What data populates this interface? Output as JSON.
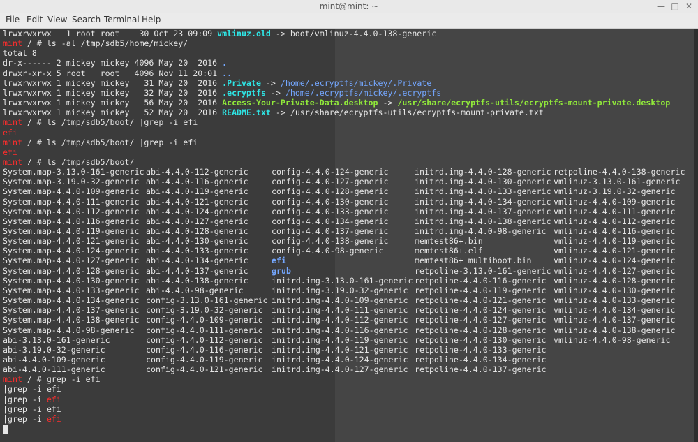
{
  "window": {
    "title": "mint@mint: ~",
    "menu": [
      "File",
      "Edit",
      "View",
      "Search",
      "Terminal",
      "Help"
    ],
    "controls": [
      "—",
      "□",
      "✕"
    ]
  },
  "terminal": {
    "lines": [
      [
        {
          "t": "lrwxrwxrwx   1 root root    30 Oct 23 09:09 "
        },
        {
          "t": "vmlinuz.old",
          "c": "cyan",
          "b": true
        },
        {
          "t": " -> boot/vmlinuz-4.4.0-138-generic"
        }
      ],
      [
        {
          "t": "mint",
          "c": "red"
        },
        {
          "t": " / # ls -al /tmp/sdb5/home/mickey/"
        }
      ],
      [
        {
          "t": "total 8"
        }
      ],
      [
        {
          "t": "dr-x------ 2 mickey mickey 4096 May 20  2016 "
        },
        {
          "t": ".",
          "c": "blue",
          "b": true
        }
      ],
      [
        {
          "t": "drwxr-xr-x 5 root   root   4096 Nov 11 20:01 "
        },
        {
          "t": "..",
          "c": "blue",
          "b": true
        }
      ],
      [
        {
          "t": "lrwxrwxrwx 1 mickey mickey   31 May 20  2016 "
        },
        {
          "t": ".Private",
          "c": "cyan",
          "b": true
        },
        {
          "t": " -> "
        },
        {
          "t": "/home/.ecryptfs/mickey/.Private",
          "c": "blue"
        }
      ],
      [
        {
          "t": "lrwxrwxrwx 1 mickey mickey   32 May 20  2016 "
        },
        {
          "t": ".ecryptfs",
          "c": "cyan",
          "b": true
        },
        {
          "t": " -> "
        },
        {
          "t": "/home/.ecryptfs/mickey/.ecryptfs",
          "c": "blue"
        }
      ],
      [
        {
          "t": "lrwxrwxrwx 1 mickey mickey   56 May 20  2016 "
        },
        {
          "t": "Access-Your-Private-Data.desktop",
          "c": "green",
          "b": true
        },
        {
          "t": " -> "
        },
        {
          "t": "/usr/share/ecryptfs-utils/ecryptfs-mount-private.desktop",
          "c": "green",
          "b": true
        }
      ],
      [
        {
          "t": "lrwxrwxrwx 1 mickey mickey   52 May 20  2016 "
        },
        {
          "t": "README.txt",
          "c": "cyan",
          "b": true
        },
        {
          "t": " -> /usr/share/ecryptfs-utils/ecryptfs-mount-private.txt"
        }
      ],
      [
        {
          "t": "mint",
          "c": "red"
        },
        {
          "t": " / # ls /tmp/sdb5/boot/ |grep -i efi"
        }
      ],
      [
        {
          "t": "efi",
          "c": "red"
        }
      ],
      [
        {
          "t": "mint",
          "c": "red"
        },
        {
          "t": " / # ls /tmp/sdb5/boot/ |grep -i efi"
        }
      ],
      [
        {
          "t": "efi",
          "c": "red"
        }
      ],
      [
        {
          "t": "mint",
          "c": "red"
        },
        {
          "t": " / # ls /tmp/sdb5/boot/"
        }
      ]
    ],
    "listing": {
      "columns": [
        [
          "System.map-3.13.0-161-generic",
          "System.map-3.19.0-32-generic",
          "System.map-4.4.0-109-generic",
          "System.map-4.4.0-111-generic",
          "System.map-4.4.0-112-generic",
          "System.map-4.4.0-116-generic",
          "System.map-4.4.0-119-generic",
          "System.map-4.4.0-121-generic",
          "System.map-4.4.0-124-generic",
          "System.map-4.4.0-127-generic",
          "System.map-4.4.0-128-generic",
          "System.map-4.4.0-130-generic",
          "System.map-4.4.0-133-generic",
          "System.map-4.4.0-134-generic",
          "System.map-4.4.0-137-generic",
          "System.map-4.4.0-138-generic",
          "System.map-4.4.0-98-generic",
          "abi-3.13.0-161-generic",
          "abi-3.19.0-32-generic",
          "abi-4.4.0-109-generic",
          "abi-4.4.0-111-generic"
        ],
        [
          "abi-4.4.0-112-generic",
          "abi-4.4.0-116-generic",
          "abi-4.4.0-119-generic",
          "abi-4.4.0-121-generic",
          "abi-4.4.0-124-generic",
          "abi-4.4.0-127-generic",
          "abi-4.4.0-128-generic",
          "abi-4.4.0-130-generic",
          "abi-4.4.0-133-generic",
          "abi-4.4.0-134-generic",
          "abi-4.4.0-137-generic",
          "abi-4.4.0-138-generic",
          "abi-4.4.0-98-generic",
          "config-3.13.0-161-generic",
          "config-3.19.0-32-generic",
          "config-4.4.0-109-generic",
          "config-4.4.0-111-generic",
          "config-4.4.0-112-generic",
          "config-4.4.0-116-generic",
          "config-4.4.0-119-generic",
          "config-4.4.0-121-generic"
        ],
        [
          "config-4.4.0-124-generic",
          "config-4.4.0-127-generic",
          "config-4.4.0-128-generic",
          "config-4.4.0-130-generic",
          "config-4.4.0-133-generic",
          "config-4.4.0-134-generic",
          "config-4.4.0-137-generic",
          "config-4.4.0-138-generic",
          "config-4.4.0-98-generic",
          {
            "t": "efi",
            "c": "blue",
            "b": true
          },
          {
            "t": "grub",
            "c": "blue",
            "b": true
          },
          "initrd.img-3.13.0-161-generic",
          "initrd.img-3.19.0-32-generic",
          "initrd.img-4.4.0-109-generic",
          "initrd.img-4.4.0-111-generic",
          "initrd.img-4.4.0-112-generic",
          "initrd.img-4.4.0-116-generic",
          "initrd.img-4.4.0-119-generic",
          "initrd.img-4.4.0-121-generic",
          "initrd.img-4.4.0-124-generic",
          "initrd.img-4.4.0-127-generic"
        ],
        [
          "initrd.img-4.4.0-128-generic",
          "initrd.img-4.4.0-130-generic",
          "initrd.img-4.4.0-133-generic",
          "initrd.img-4.4.0-134-generic",
          "initrd.img-4.4.0-137-generic",
          "initrd.img-4.4.0-138-generic",
          "initrd.img-4.4.0-98-generic",
          "memtest86+.bin",
          "memtest86+.elf",
          "memtest86+_multiboot.bin",
          "retpoline-3.13.0-161-generic",
          "retpoline-4.4.0-116-generic",
          "retpoline-4.4.0-119-generic",
          "retpoline-4.4.0-121-generic",
          "retpoline-4.4.0-124-generic",
          "retpoline-4.4.0-127-generic",
          "retpoline-4.4.0-128-generic",
          "retpoline-4.4.0-130-generic",
          "retpoline-4.4.0-133-generic",
          "retpoline-4.4.0-134-generic",
          "retpoline-4.4.0-137-generic"
        ],
        [
          "retpoline-4.4.0-138-generic",
          "vmlinuz-3.13.0-161-generic",
          "vmlinuz-3.19.0-32-generic",
          "vmlinuz-4.4.0-109-generic",
          "vmlinuz-4.4.0-111-generic",
          "vmlinuz-4.4.0-112-generic",
          "vmlinuz-4.4.0-116-generic",
          "vmlinuz-4.4.0-119-generic",
          "vmlinuz-4.4.0-121-generic",
          "vmlinuz-4.4.0-124-generic",
          "vmlinuz-4.4.0-127-generic",
          "vmlinuz-4.4.0-128-generic",
          "vmlinuz-4.4.0-130-generic",
          "vmlinuz-4.4.0-133-generic",
          "vmlinuz-4.4.0-134-generic",
          "vmlinuz-4.4.0-137-generic",
          "vmlinuz-4.4.0-138-generic",
          "vmlinuz-4.4.0-98-generic"
        ]
      ]
    },
    "after": [
      [
        {
          "t": "mint",
          "c": "red"
        },
        {
          "t": " / # grep -i efi"
        }
      ],
      [
        {
          "t": "|grep -i efi"
        }
      ],
      [
        {
          "t": "|grep -i "
        },
        {
          "t": "efi",
          "c": "red"
        }
      ],
      [
        {
          "t": "|grep -i efi"
        }
      ],
      [
        {
          "t": "|grep -i "
        },
        {
          "t": "efi",
          "c": "red"
        }
      ]
    ]
  }
}
